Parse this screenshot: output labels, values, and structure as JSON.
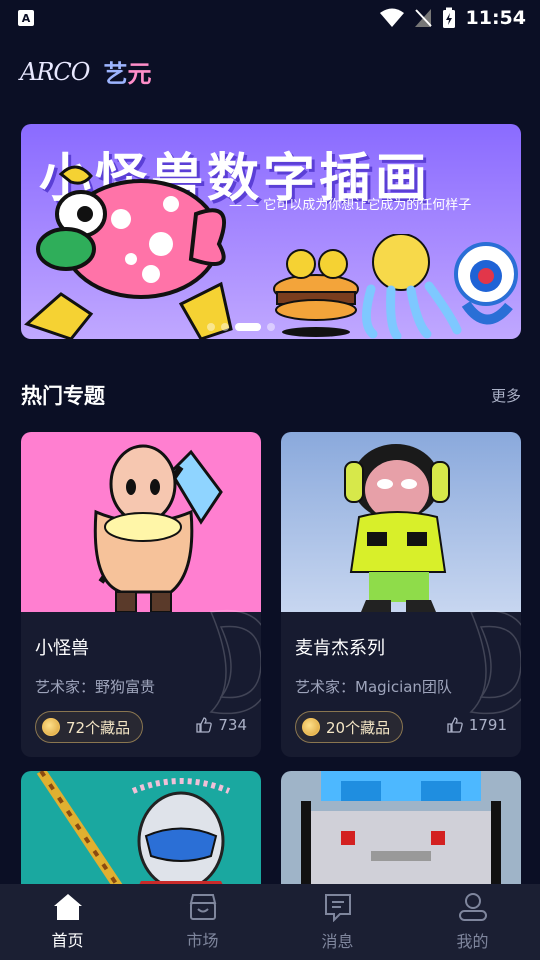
{
  "status_bar": {
    "time": "11:54",
    "app_badge": "A"
  },
  "logo": {
    "en": "ARCO",
    "cn_first": "艺",
    "cn_second": "元"
  },
  "banner": {
    "title": "小怪兽数字插画",
    "subtitle": "— — 它可以成为你想让它成为的任何样子",
    "dots": 4,
    "active_dot": 2
  },
  "section": {
    "title": "热门专题",
    "more": "更多"
  },
  "cards": [
    {
      "name": "小怪兽",
      "artist": "艺术家：野狗富贵",
      "collect": "72个藏品",
      "likes": "734"
    },
    {
      "name": "麦肯杰系列",
      "artist": "艺术家：Magician团队",
      "collect": "20个藏品",
      "likes": "1791"
    }
  ],
  "tabs": [
    {
      "label": "首页",
      "icon": "home-icon",
      "active": true
    },
    {
      "label": "市场",
      "icon": "market-icon",
      "active": false
    },
    {
      "label": "消息",
      "icon": "message-icon",
      "active": false
    },
    {
      "label": "我的",
      "icon": "profile-icon",
      "active": false
    }
  ],
  "colors": {
    "background": "#0b0f25",
    "card": "#171b30",
    "banner": "#8a6bff",
    "tabbar": "#1b1f33"
  }
}
